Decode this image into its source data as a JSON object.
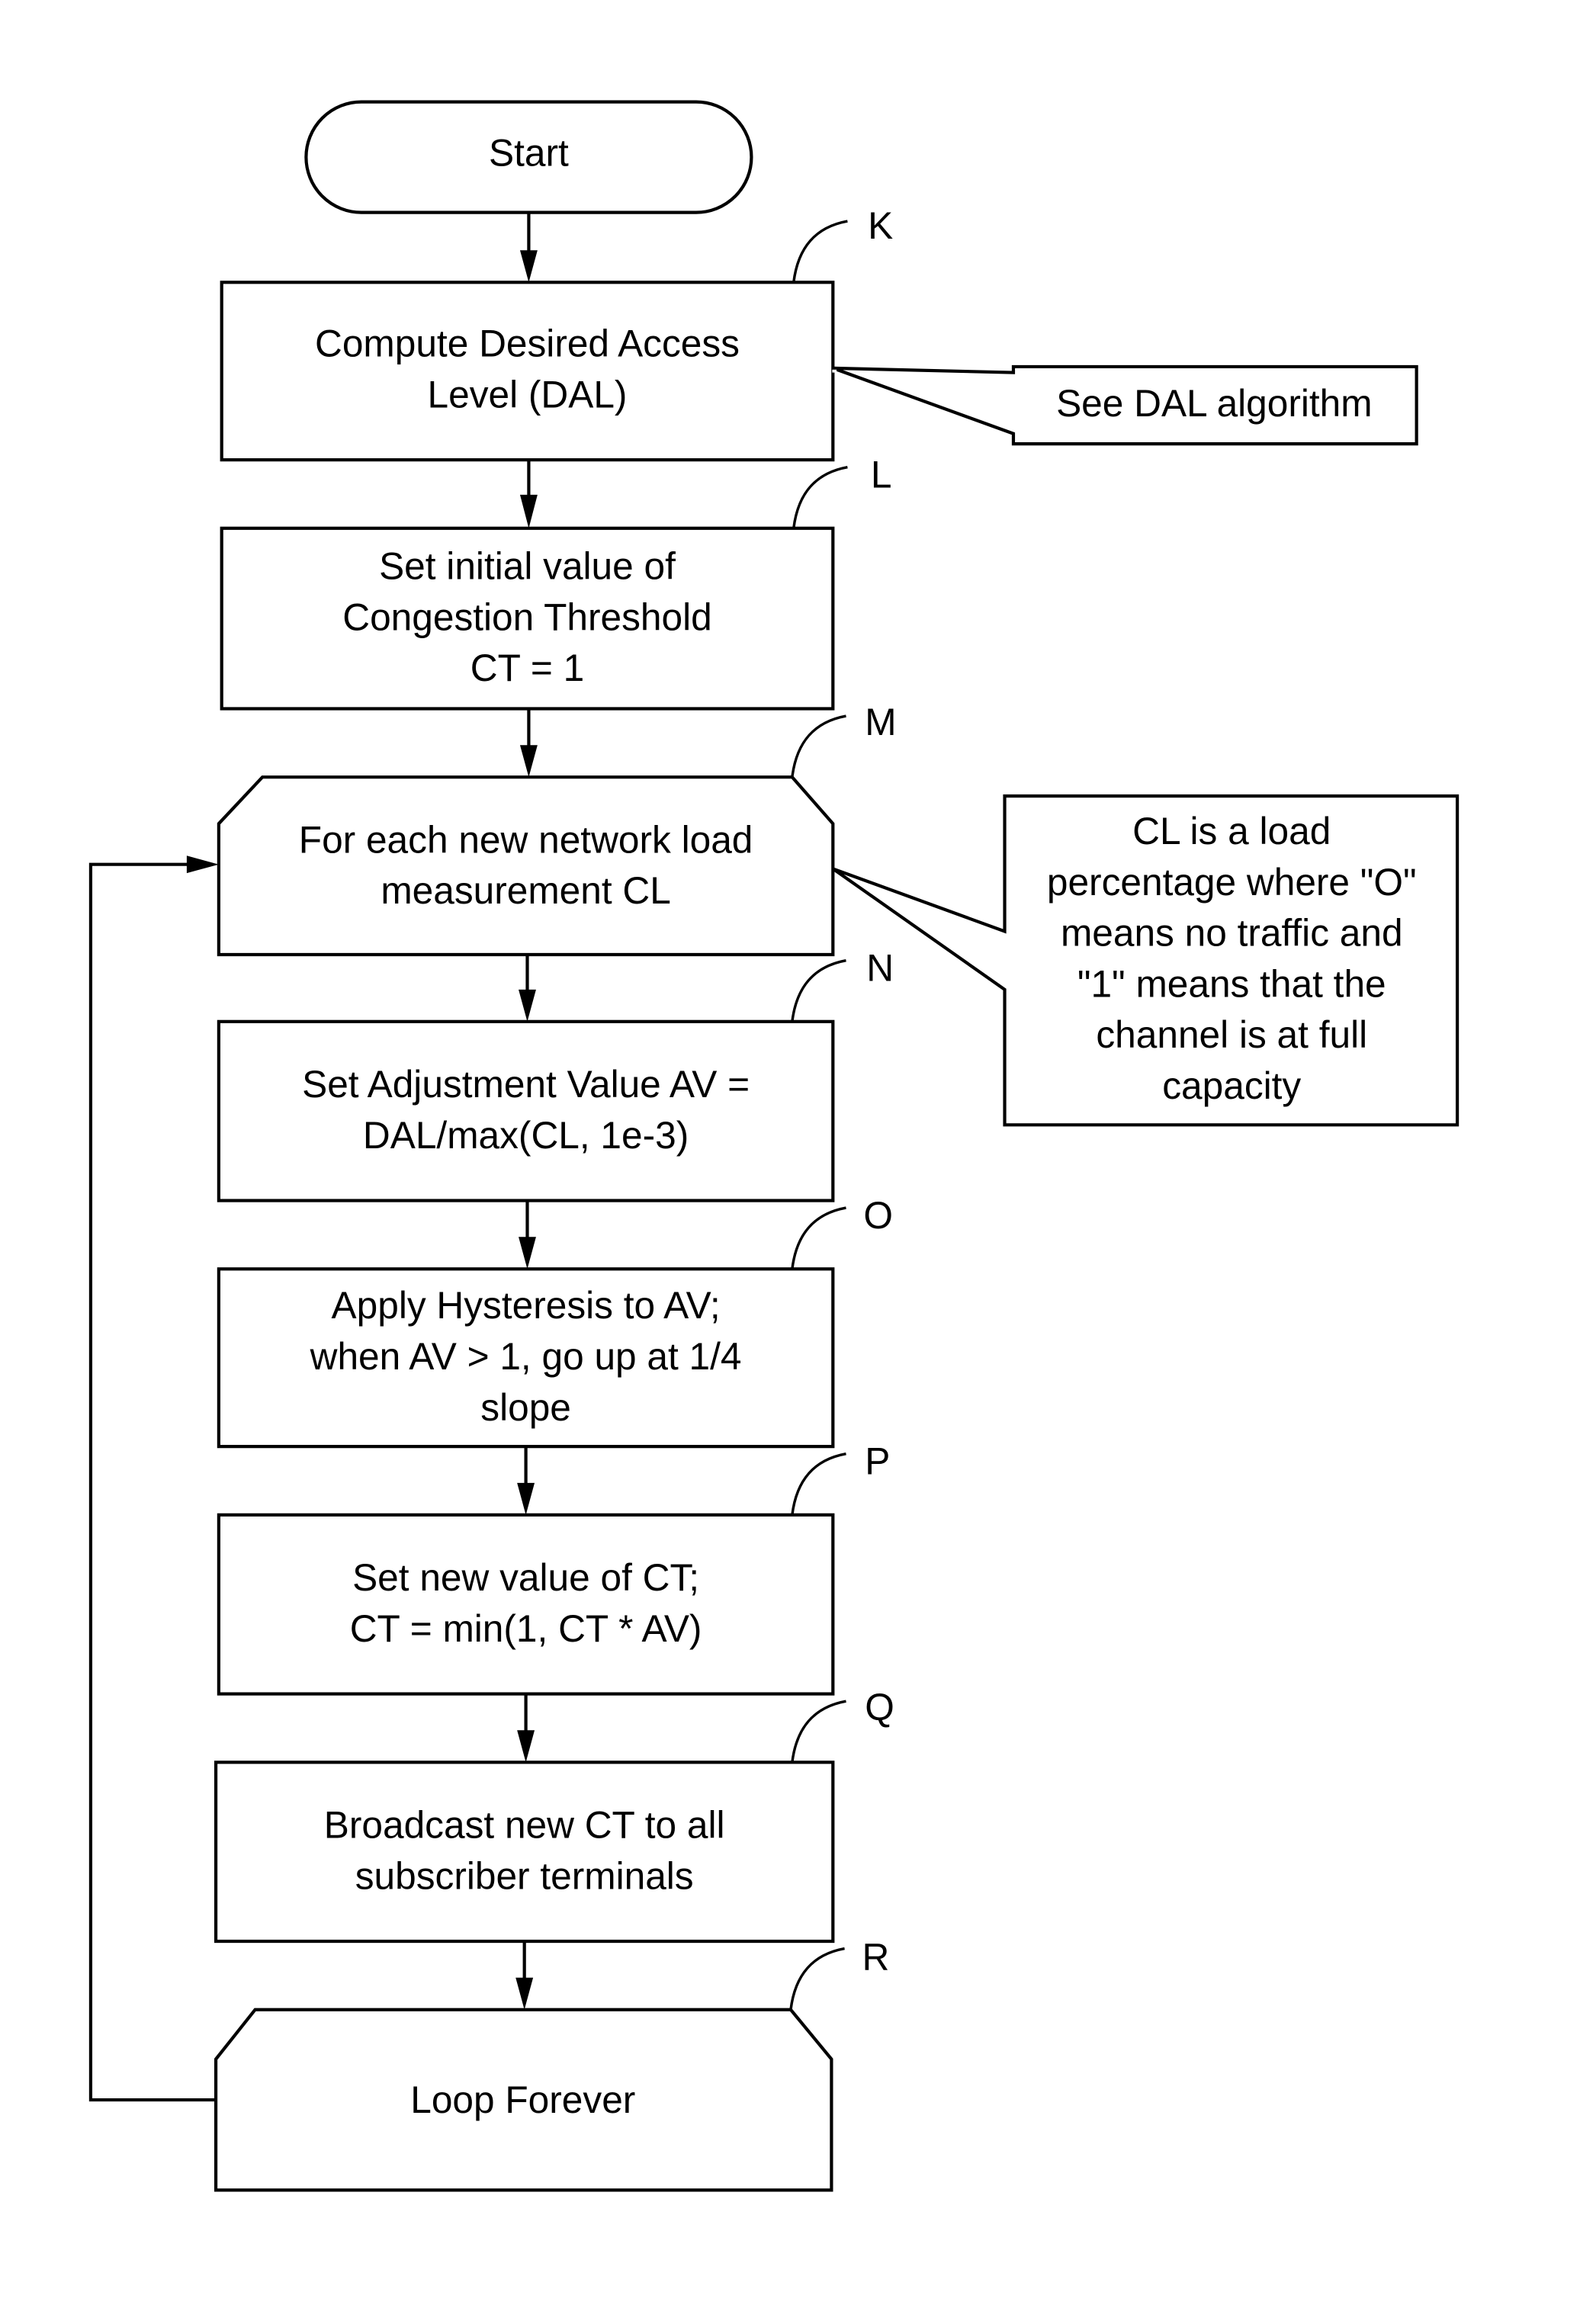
{
  "diagram": {
    "type": "flowchart",
    "start": {
      "label": "Start"
    },
    "steps": [
      {
        "ref": "K",
        "lines": [
          "Compute Desired Access",
          "Level (DAL)"
        ],
        "shape": "process"
      },
      {
        "ref": "L",
        "lines": [
          "Set initial value of",
          "Congestion Threshold",
          "CT = 1"
        ],
        "shape": "process"
      },
      {
        "ref": "M",
        "lines": [
          "For each new network load",
          "measurement CL"
        ],
        "shape": "loop-start"
      },
      {
        "ref": "N",
        "lines": [
          "Set Adjustment Value AV =",
          "DAL/max(CL, 1e-3)"
        ],
        "shape": "process"
      },
      {
        "ref": "O",
        "lines": [
          "Apply Hysteresis to AV;",
          "when AV > 1, go up at 1/4",
          "slope"
        ],
        "shape": "process"
      },
      {
        "ref": "P",
        "lines": [
          "Set new value of CT;",
          "CT = min(1, CT * AV)"
        ],
        "shape": "process"
      },
      {
        "ref": "Q",
        "lines": [
          "Broadcast new CT to all",
          "subscriber terminals"
        ],
        "shape": "process"
      },
      {
        "ref": "R",
        "lines": [
          "Loop Forever"
        ],
        "shape": "loop-end"
      }
    ],
    "callouts": [
      {
        "attached_to": "K",
        "lines": [
          "See DAL algorithm"
        ]
      },
      {
        "attached_to": "M",
        "lines": [
          "CL is a load",
          "percentage where \"O\"",
          "means no traffic and",
          "\"1\" means that the",
          "channel is at full",
          "capacity"
        ]
      }
    ],
    "loop_back": {
      "from": "R",
      "to": "M"
    }
  }
}
